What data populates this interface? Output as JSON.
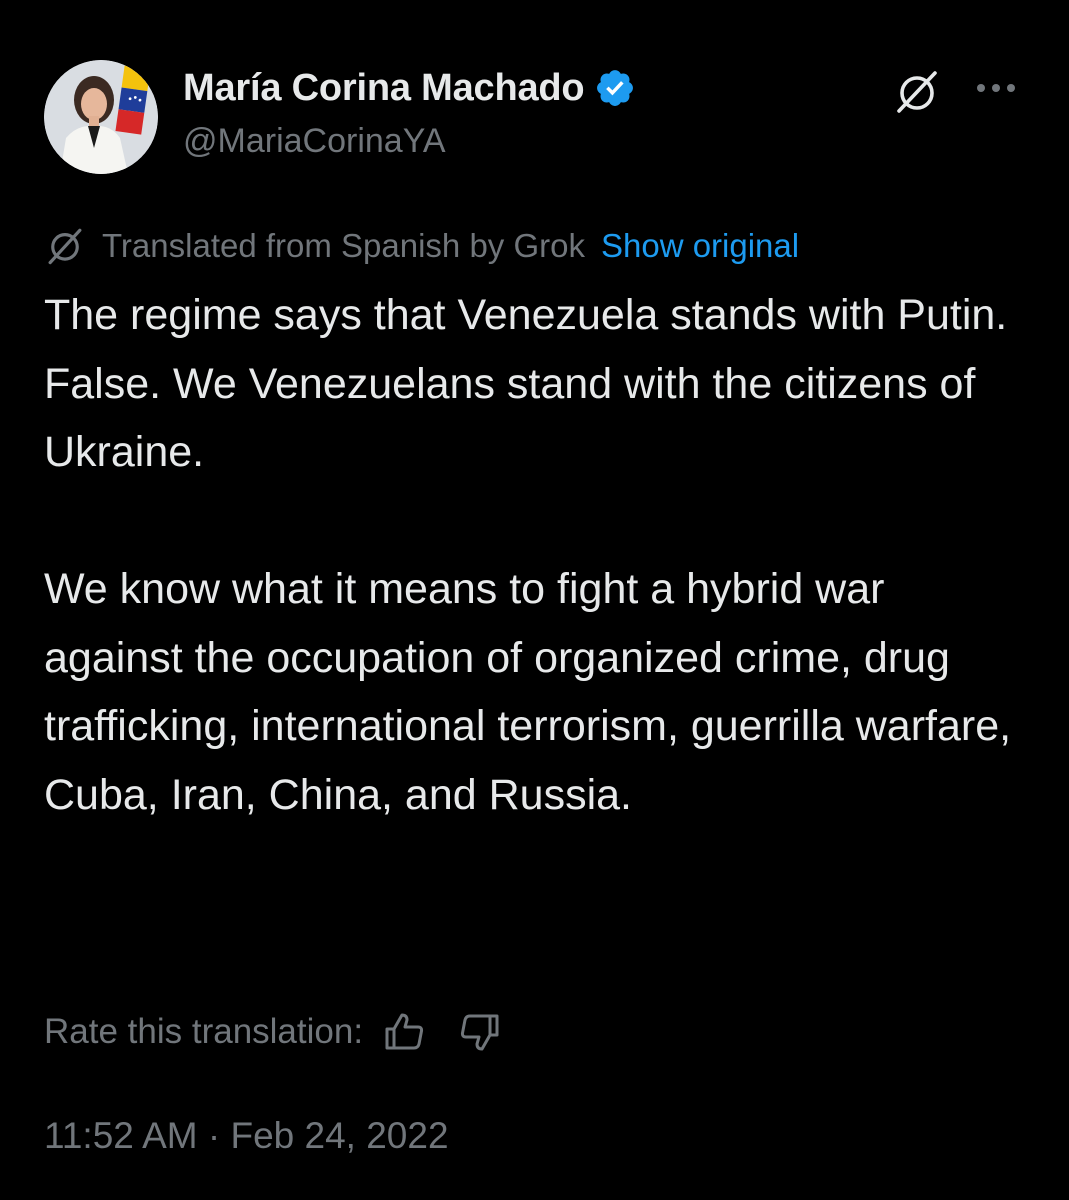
{
  "author": {
    "display_name": "María Corina Machado",
    "handle": "@MariaCorinaYA",
    "verified": true
  },
  "header_actions": {
    "grok_icon": "grok-slash-icon",
    "more_icon": "more-horizontal-icon"
  },
  "translation": {
    "label": "Translated from Spanish by Grok",
    "show_original": "Show original",
    "rate_label": "Rate this translation:",
    "thumb_up_icon": "thumbs-up-icon",
    "thumb_down_icon": "thumbs-down-icon"
  },
  "tweet": {
    "paragraphs": [
      "The regime says that Venezuela stands with Putin.",
      "False. We Venezuelans stand with the citizens of Ukraine.",
      "We know what it means to fight a hybrid war against the occupation of organized crime, drug trafficking, international terrorism, guerrilla warfare, Cuba, Iran, China, and Russia."
    ],
    "timestamp": "11:52 AM · Feb 24, 2022"
  },
  "colors": {
    "background": "#000000",
    "primary_text": "#e7e9ea",
    "secondary_text": "#71767b",
    "link": "#1d9bf0",
    "verified_badge": "#1d9bf0"
  }
}
